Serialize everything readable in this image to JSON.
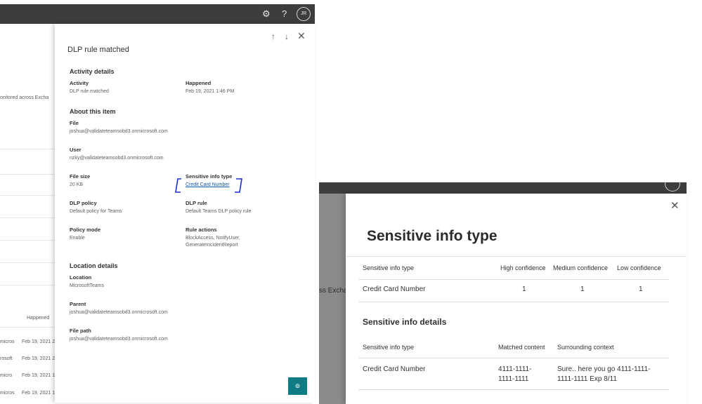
{
  "left": {
    "topbar": {
      "settings_icon": "gear-icon",
      "help_icon": "question-icon",
      "avatar": "JR"
    },
    "background": {
      "partial_text": "onitored across Excha",
      "happened_header": "Happened",
      "rows": [
        {
          "a": "micros",
          "b": "Feb 19, 2021 2:4"
        },
        {
          "a": "rosoft",
          "b": "Feb 19, 2021 2:"
        },
        {
          "a": "micro",
          "b": "Feb 19, 2021 1:"
        },
        {
          "a": "micros",
          "b": "Feb 19, 2021 1:"
        }
      ]
    },
    "panel": {
      "title": "DLP rule matched",
      "nav": {
        "up_icon": "arrow-up-icon",
        "down_icon": "arrow-down-icon",
        "close_icon": "close-icon"
      },
      "activity_details": {
        "heading": "Activity details",
        "activity_label": "Activity",
        "activity_value": "DLP rule matched",
        "happened_label": "Happened",
        "happened_value": "Feb 19, 2021 1:46 PM"
      },
      "about_item": {
        "heading": "About this item",
        "file_label": "File",
        "file_value": "joshua@validateteamsobd3.onmicrosoft.com",
        "user_label": "User",
        "user_value": "rizky@validateteamsobd3.onmicrosoft.com",
        "file_size_label": "File size",
        "file_size_value": "20 KB",
        "sit_label": "Sensitive info type",
        "sit_value": "Credit Card Number",
        "dlp_policy_label": "DLP policy",
        "dlp_policy_value": "Default policy for Teams",
        "dlp_rule_label": "DLP rule",
        "dlp_rule_value": "Default Teams DLP policy rule",
        "policy_mode_label": "Policy mode",
        "policy_mode_value": "Enable",
        "rule_actions_label": "Rule actions",
        "rule_actions_line1": "BlockAccess, NotifyUser,",
        "rule_actions_line2": "GenerateIncidentReport"
      },
      "location_details": {
        "heading": "Location details",
        "location_label": "Location",
        "location_value": "MicrosoftTeams",
        "parent_label": "Parent",
        "parent_value": "joshua@validateteamsobd3.onmicrosoft.com",
        "file_path_label": "File path",
        "file_path_value": "joshua@validateteamsobd3.onmicrosoft.com"
      },
      "help_icon": "question-circle-icon"
    },
    "annotation_color": "#1a2fd6"
  },
  "right": {
    "background": {
      "partial_text": "ss Excha"
    },
    "panel": {
      "title": "Sensitive info type",
      "close_icon": "close-icon",
      "table1": {
        "headers": [
          "Sensitive info type",
          "High confidence",
          "Medium confidence",
          "Low confidence"
        ],
        "row": [
          "Credit Card Number",
          "1",
          "1",
          "1"
        ]
      },
      "details_heading": "Sensitive info details",
      "table2": {
        "headers": [
          "Sensitive info type",
          "Matched content",
          "Surrounding context"
        ],
        "row": {
          "type": "Credit Card Number",
          "matched_line1": "4111-1111-",
          "matched_line2": "1111-1111",
          "context_line1": "Sure.. here you go 4111-1111-",
          "context_line2": "1111-1111 Exp 8/11"
        }
      }
    }
  }
}
